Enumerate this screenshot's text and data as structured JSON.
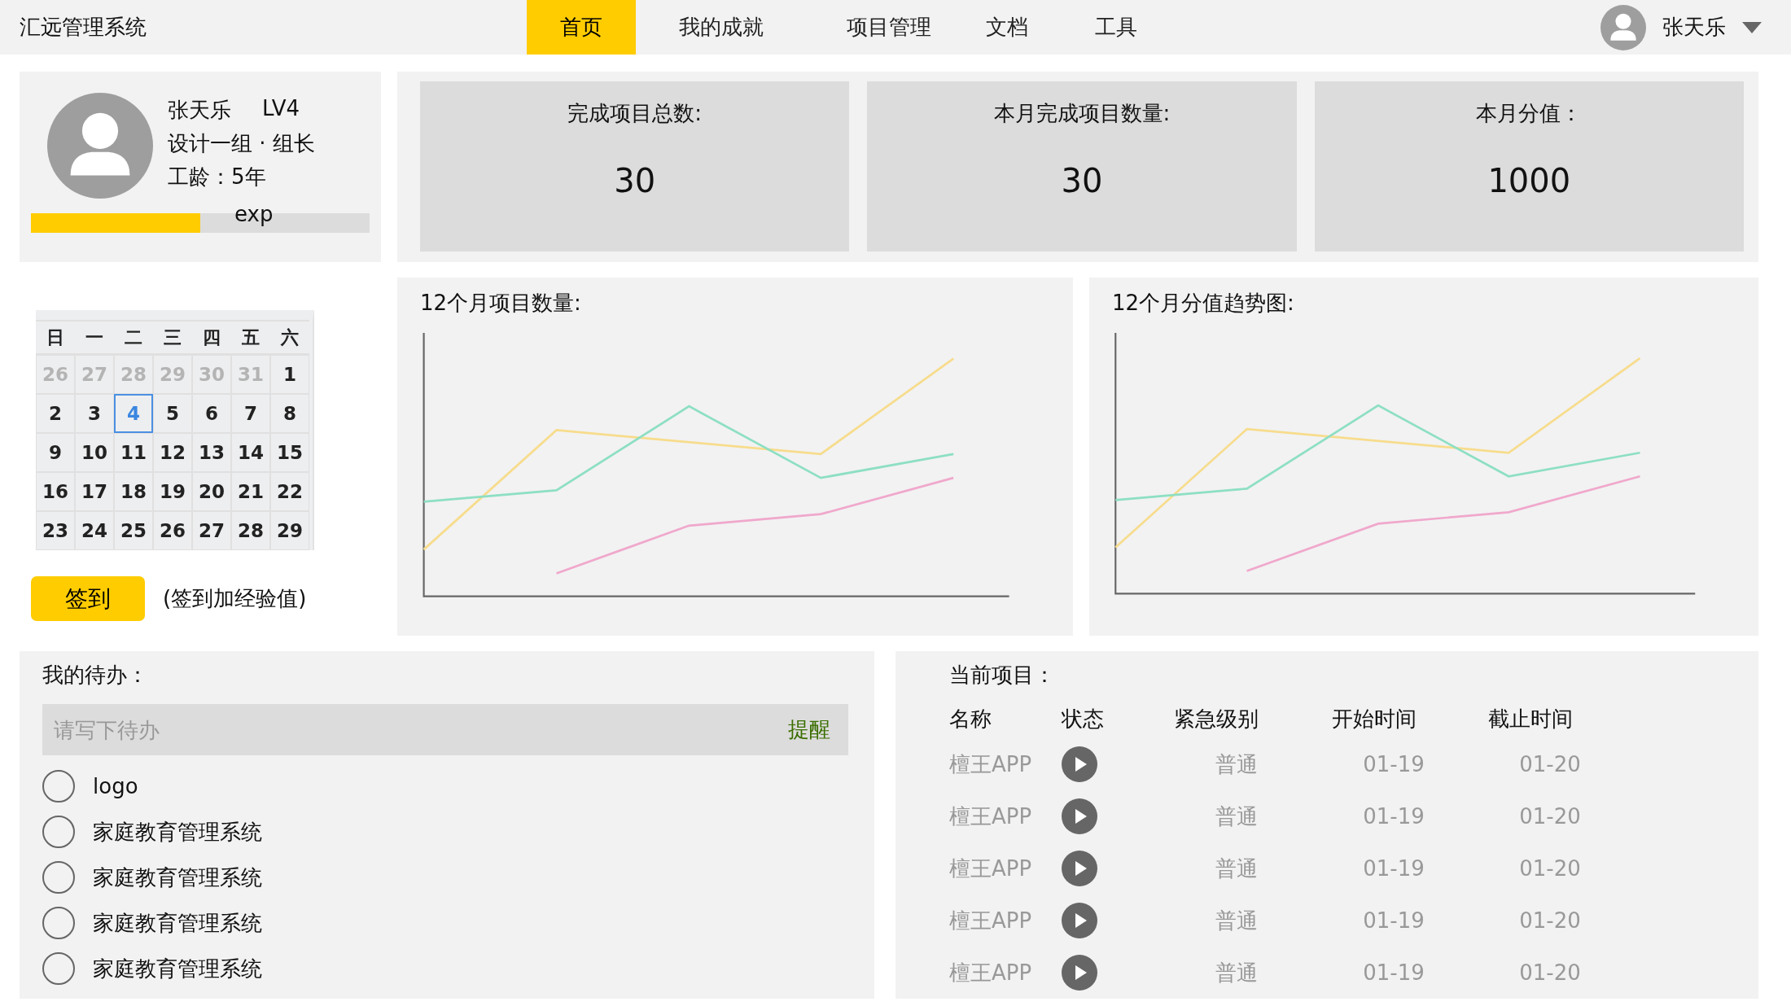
{
  "app_title": "汇远管理系统",
  "nav": [
    {
      "label": "首页",
      "selected": true
    },
    {
      "label": "我的成就",
      "selected": false
    },
    {
      "label": "项目管理",
      "selected": false
    },
    {
      "label": "文档",
      "selected": false
    },
    {
      "label": "工具",
      "selected": false
    }
  ],
  "user": {
    "name": "张天乐"
  },
  "profile": {
    "name": "张天乐",
    "level_label": "LV4",
    "team": "设计一组 · 组长",
    "tenure": "工龄：5年",
    "exp_label": "exp",
    "level": 0.5
  },
  "stats": [
    {
      "label": "完成项目总数:",
      "value": "30"
    },
    {
      "label": "本月完成项目数量:",
      "value": "30"
    },
    {
      "label": "本月分值：",
      "value": "1000"
    }
  ],
  "calendar": {
    "weekdays": [
      "日",
      "一",
      "二",
      "三",
      "四",
      "五",
      "六"
    ],
    "days": [
      {
        "label": "26",
        "muted": true,
        "selected": false
      },
      {
        "label": "27",
        "muted": true,
        "selected": false
      },
      {
        "label": "28",
        "muted": true,
        "selected": false
      },
      {
        "label": "29",
        "muted": true,
        "selected": false
      },
      {
        "label": "30",
        "muted": true,
        "selected": false
      },
      {
        "label": "31",
        "muted": true,
        "selected": false
      },
      {
        "label": "1",
        "muted": false,
        "selected": false
      },
      {
        "label": "2",
        "muted": false,
        "selected": false
      },
      {
        "label": "3",
        "muted": false,
        "selected": false
      },
      {
        "label": "4",
        "muted": false,
        "selected": true
      },
      {
        "label": "5",
        "muted": false,
        "selected": false
      },
      {
        "label": "6",
        "muted": false,
        "selected": false
      },
      {
        "label": "7",
        "muted": false,
        "selected": false
      },
      {
        "label": "8",
        "muted": false,
        "selected": false
      },
      {
        "label": "9",
        "muted": false,
        "selected": false
      },
      {
        "label": "10",
        "muted": false,
        "selected": false
      },
      {
        "label": "11",
        "muted": false,
        "selected": false
      },
      {
        "label": "12",
        "muted": false,
        "selected": false
      },
      {
        "label": "13",
        "muted": false,
        "selected": false
      },
      {
        "label": "14",
        "muted": false,
        "selected": false
      },
      {
        "label": "15",
        "muted": false,
        "selected": false
      },
      {
        "label": "16",
        "muted": false,
        "selected": false
      },
      {
        "label": "17",
        "muted": false,
        "selected": false
      },
      {
        "label": "18",
        "muted": false,
        "selected": false
      },
      {
        "label": "19",
        "muted": false,
        "selected": false
      },
      {
        "label": "20",
        "muted": false,
        "selected": false
      },
      {
        "label": "21",
        "muted": false,
        "selected": false
      },
      {
        "label": "22",
        "muted": false,
        "selected": false
      },
      {
        "label": "23",
        "muted": false,
        "selected": false
      },
      {
        "label": "24",
        "muted": false,
        "selected": false
      },
      {
        "label": "25",
        "muted": false,
        "selected": false
      },
      {
        "label": "26",
        "muted": false,
        "selected": false
      },
      {
        "label": "27",
        "muted": false,
        "selected": false
      },
      {
        "label": "28",
        "muted": false,
        "selected": false
      },
      {
        "label": "29",
        "muted": false,
        "selected": false
      }
    ]
  },
  "checkin": {
    "button": "签到",
    "note": "(签到加经验值)"
  },
  "charts": [
    {
      "title": "12个月项目数量:"
    },
    {
      "title": "12个月分值趋势图:"
    }
  ],
  "todo": {
    "title": "我的待办：",
    "placeholder": "请写下待办",
    "remind": "提醒",
    "items": [
      {
        "label": "logo",
        "checked": false
      },
      {
        "label": "家庭教育管理系统",
        "checked": false
      },
      {
        "label": "家庭教育管理系统",
        "checked": false
      },
      {
        "label": "家庭教育管理系统",
        "checked": false
      },
      {
        "label": "家庭教育管理系统",
        "checked": false
      }
    ]
  },
  "projects": {
    "title": "当前项目：",
    "columns": [
      "名称",
      "状态",
      "紧急级别",
      "开始时间",
      "截止时间"
    ],
    "rows": [
      {
        "name": "檀王APP",
        "priority": "普通",
        "start": "01-19",
        "end": "01-20"
      },
      {
        "name": "檀王APP",
        "priority": "普通",
        "start": "01-19",
        "end": "01-20"
      },
      {
        "name": "檀王APP",
        "priority": "普通",
        "start": "01-19",
        "end": "01-20"
      },
      {
        "name": "檀王APP",
        "priority": "普通",
        "start": "01-19",
        "end": "01-20"
      },
      {
        "name": "檀王APP",
        "priority": "普通",
        "start": "01-19",
        "end": "01-20"
      }
    ]
  }
}
